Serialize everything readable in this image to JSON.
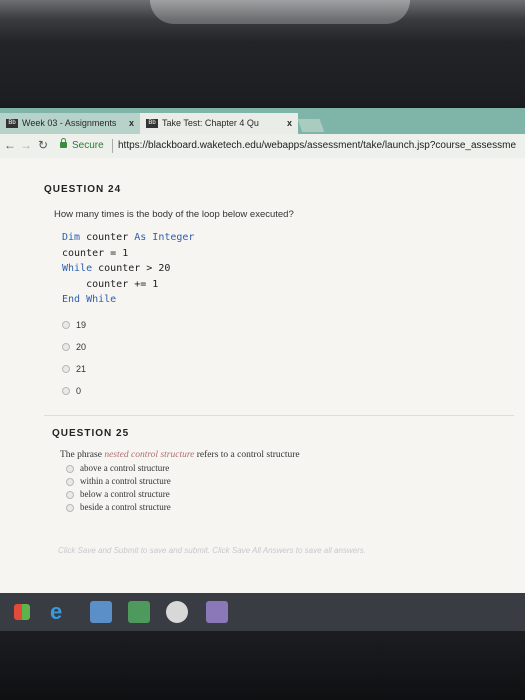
{
  "browser": {
    "tabs": [
      {
        "label": "Week 03 - Assignments",
        "close": "x"
      },
      {
        "label": "Take Test: Chapter 4 Qu",
        "close": "x"
      }
    ],
    "secure_label": "Secure",
    "url": "https://blackboard.waketech.edu/webapps/assessment/take/launch.jsp?course_assessme"
  },
  "q24": {
    "title": "QUESTION 24",
    "prompt": "How many times is the body of the loop below executed?",
    "code": {
      "l1_kw1": "Dim",
      "l1_mid": " counter ",
      "l1_kw2": "As Integer",
      "l2": "counter = 1",
      "l3_kw": "While",
      "l3_rest": " counter > 20",
      "l4": "    counter += 1",
      "l5_kw1": "End",
      "l5_kw2": " While"
    },
    "options": [
      "19",
      "20",
      "21",
      "0"
    ]
  },
  "q25": {
    "title": "QUESTION 25",
    "prompt_start": "The phrase ",
    "prompt_term": "nested control structure",
    "prompt_end": " refers to a control structure",
    "options": [
      "above a control structure",
      "within a control structure",
      "below a control structure",
      "beside a control structure"
    ]
  },
  "footer_hint": "Click Save and Submit to save and submit. Click Save All Answers to save all answers.",
  "colors": {
    "code_keyword": "#2d5fb0",
    "tab_bar": "#7fb4a8",
    "secure": "#2f7a33"
  }
}
